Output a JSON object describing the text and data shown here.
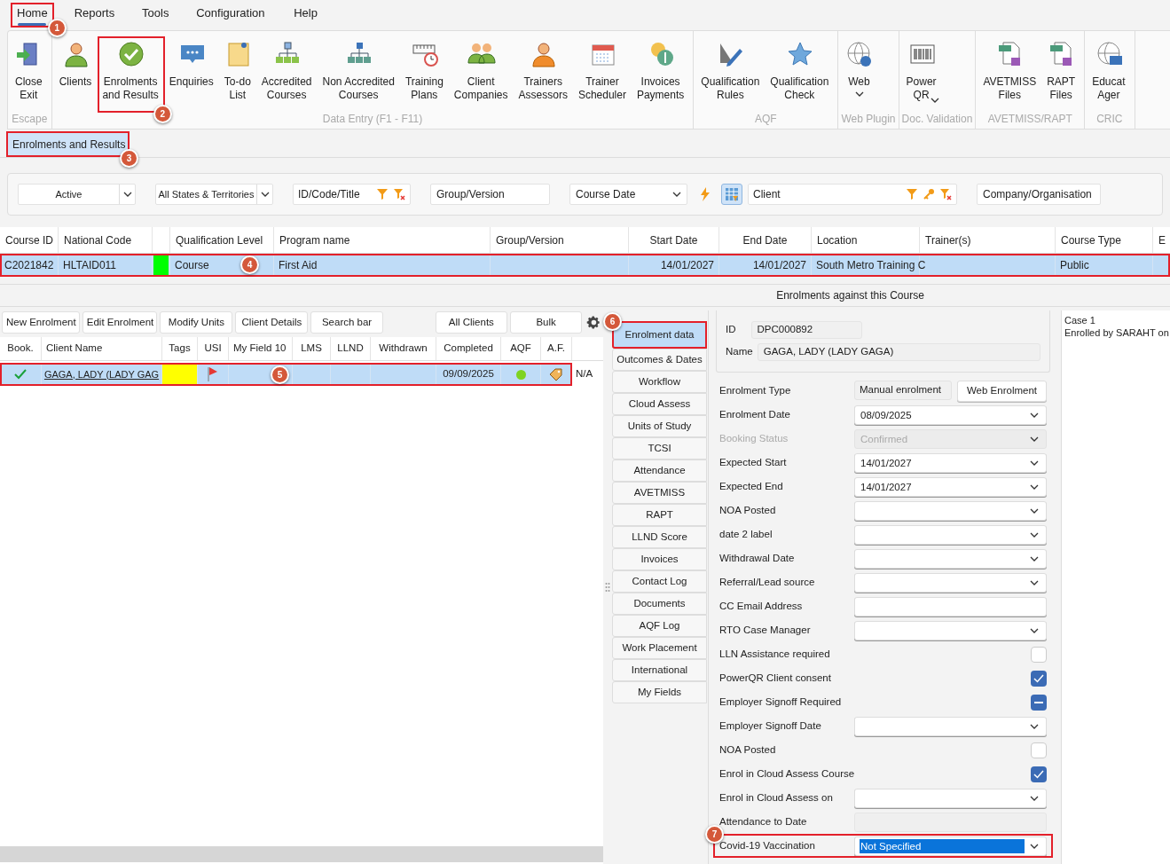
{
  "menu": [
    {
      "label": "Home",
      "selected": true,
      "callout": "1"
    },
    {
      "label": "Reports",
      "selected": false
    },
    {
      "label": "Tools",
      "selected": false
    },
    {
      "label": "Configuration",
      "selected": false
    },
    {
      "label": "Help",
      "selected": false
    }
  ],
  "ribbon": [
    {
      "label": "Escape",
      "items": [
        {
          "label": "Close\nExit"
        }
      ]
    },
    {
      "label": "Data Entry (F1 - F11)",
      "items": [
        {
          "label": "Clients"
        },
        {
          "label": "Enrolments\nand Results",
          "callout": "2"
        },
        {
          "label": "Enquiries"
        },
        {
          "label": "To-do\nList"
        },
        {
          "label": "Accredited\nCourses"
        },
        {
          "label": "Non Accredited\nCourses"
        },
        {
          "label": "Training\nPlans"
        },
        {
          "label": "Client\nCompanies"
        },
        {
          "label": "Trainers\nAssessors"
        },
        {
          "label": "Trainer\nScheduler"
        },
        {
          "label": "Invoices\nPayments"
        }
      ]
    },
    {
      "label": "AQF",
      "items": [
        {
          "label": "Qualification\nRules"
        },
        {
          "label": "Qualification\nCheck"
        }
      ]
    },
    {
      "label": "Web Plugin",
      "items": [
        {
          "label": "Web",
          "dropdown": true
        }
      ]
    },
    {
      "label": "Doc. Validation",
      "items": [
        {
          "label": "Power\nQR",
          "dropdown": true
        }
      ]
    },
    {
      "label": "AVETMISS/RAPT",
      "items": [
        {
          "label": "AVETMISS\nFiles"
        },
        {
          "label": "RAPT\nFiles"
        }
      ]
    },
    {
      "label": "CRIC",
      "items": [
        {
          "label": "Educat\nAger"
        }
      ]
    }
  ],
  "doc_tabs": [
    {
      "label": "Enrolments and Results",
      "selected": true,
      "callout": "3"
    }
  ],
  "filters": [
    {
      "kind": "combo",
      "value": "Active"
    },
    {
      "kind": "combo",
      "value": "All States & Territories"
    },
    {
      "kind": "search",
      "placeholder": "ID/Code/Title",
      "lookup": false
    },
    {
      "kind": "text",
      "placeholder": "Group/Version"
    },
    {
      "kind": "select",
      "value": "Course Date"
    },
    {
      "kind": "tools",
      "on": true
    },
    {
      "kind": "search",
      "placeholder": "Client",
      "lookup": true
    },
    {
      "kind": "text",
      "placeholder": "Company/Organisation"
    }
  ],
  "course_grid": {
    "columns": [
      "Course ID",
      "National Code",
      "Qualification Level",
      "Program name",
      "Group/Version",
      "Start Date",
      "End Date",
      "Location",
      "Trainer(s)",
      "Course Type",
      "E"
    ],
    "rows": [
      {
        "selected": true,
        "callout": "4",
        "color": "#00ff00",
        "course_id": "C2021842",
        "national_code": "HLTAID011",
        "qualification_level": "Course",
        "program_name": "First Aid",
        "start_date": "14/01/2027",
        "end_date": "14/01/2027",
        "location": "South Metro Training C",
        "course_type": "Public"
      }
    ]
  },
  "section_label": "Enrolments against this Course",
  "enrol_toolbar": [
    {
      "label": "New Enrolment"
    },
    {
      "label": "Edit Enrolment"
    },
    {
      "label": "Modify Units"
    },
    {
      "label": "Client Details"
    },
    {
      "label": "Search bar"
    },
    {
      "label": "All Clients"
    },
    {
      "label": "Bulk"
    }
  ],
  "enrol_grid": {
    "columns": [
      "Book.",
      "Client Name",
      "Tags",
      "USI",
      "My Field 10",
      "LMS",
      "LLND",
      "Withdrawn",
      "Completed",
      "AQF",
      "A.F."
    ],
    "rows": [
      {
        "selected": true,
        "callout": "5",
        "booked": true,
        "client_name": "GAGA, LADY (LADY GAG",
        "tag": {
          "color": "#ffff00"
        },
        "usi_flagged": true,
        "completed": "09/09/2025",
        "aqf": {
          "color": "#7ed321"
        },
        "column_12": "N/A"
      }
    ]
  },
  "side_tabs": [
    {
      "label": "Enrolment data",
      "selected": true,
      "callout": "6"
    },
    {
      "label": "Outcomes & Dates",
      "selected": false
    },
    {
      "label": "Workflow",
      "selected": false
    },
    {
      "label": "Cloud Assess",
      "selected": false
    },
    {
      "label": "Units of Study",
      "selected": false
    },
    {
      "label": "TCSI",
      "selected": false
    },
    {
      "label": "Attendance",
      "selected": false
    },
    {
      "label": "AVETMISS",
      "selected": false
    },
    {
      "label": "RAPT",
      "selected": false
    },
    {
      "label": "LLND Score",
      "selected": false
    },
    {
      "label": "Invoices",
      "selected": false
    },
    {
      "label": "Contact Log",
      "selected": false
    },
    {
      "label": "Documents",
      "selected": false
    },
    {
      "label": "AQF Log",
      "selected": false
    },
    {
      "label": "Work Placement",
      "selected": false
    },
    {
      "label": "International",
      "selected": false
    },
    {
      "label": "My Fields",
      "selected": false
    }
  ],
  "identity": {
    "id_label": "ID",
    "id": "DPC000892",
    "name_label": "Name",
    "name": "GAGA, LADY (LADY GAGA)"
  },
  "fields": [
    {
      "kind": "type",
      "label": "Enrolment Type",
      "value": "Manual enrolment",
      "button": "Web Enrolment"
    },
    {
      "kind": "dropdown",
      "label": "Enrolment Date",
      "value": "08/09/2025",
      "disabled": false
    },
    {
      "kind": "dropdown",
      "label": "Booking Status",
      "value": "Confirmed",
      "disabled": true
    },
    {
      "kind": "dropdown",
      "label": "Expected Start",
      "value": "14/01/2027",
      "disabled": false
    },
    {
      "kind": "dropdown",
      "label": "Expected End",
      "value": "14/01/2027",
      "disabled": false
    },
    {
      "kind": "dropdown",
      "label": "NOA Posted",
      "disabled": false
    },
    {
      "kind": "dropdown",
      "label": "date 2 label",
      "disabled": false
    },
    {
      "kind": "dropdown",
      "label": "Withdrawal Date",
      "disabled": false
    },
    {
      "kind": "dropdown",
      "label": "Referral/Lead source",
      "disabled": false
    },
    {
      "kind": "text",
      "label": "CC Email Address"
    },
    {
      "kind": "dropdown",
      "label": "RTO Case Manager",
      "disabled": false
    },
    {
      "kind": "checkbox",
      "label": "LLN Assistance required",
      "checked": false
    },
    {
      "kind": "checkbox",
      "label": "PowerQR Client consent",
      "checked": true
    },
    {
      "kind": "checkbox",
      "label": "Employer Signoff Required",
      "checked": true,
      "partial": true
    },
    {
      "kind": "dropdown",
      "label": "Employer Signoff Date",
      "disabled": false
    },
    {
      "kind": "checkbox",
      "label": "NOA Posted",
      "checked": false
    },
    {
      "kind": "checkbox",
      "label": "Enrol in Cloud Assess Course",
      "checked": true
    },
    {
      "kind": "dropdown",
      "label": "Enrol in Cloud Assess on",
      "disabled": false
    },
    {
      "kind": "readonly",
      "label": "Attendance to Date"
    },
    {
      "kind": "dropdown",
      "label": "Covid-19 Vaccination",
      "value": "Not Specified",
      "disabled": false,
      "highlighted": true,
      "callout": "7"
    }
  ],
  "notes": [
    "Case 1",
    "Enrolled by SARAHT on"
  ]
}
